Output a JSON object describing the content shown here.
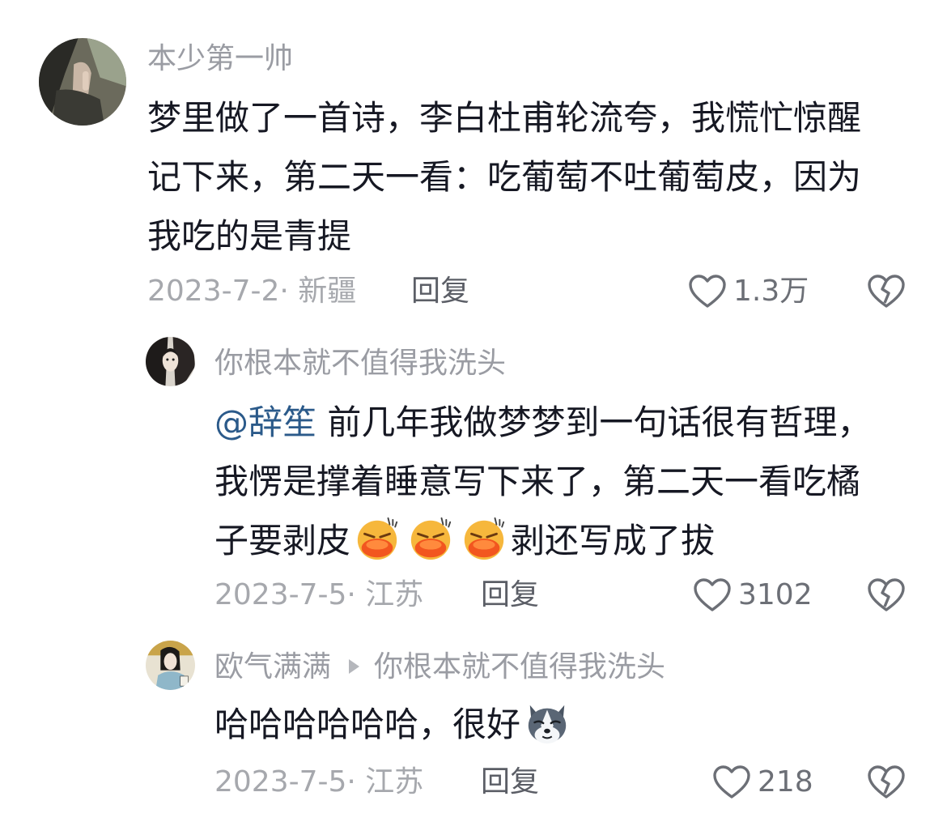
{
  "comments": [
    {
      "username": "本少第一帅",
      "lines": [
        "梦里做了一首诗，李白杜甫轮流夸，我慌忙惊醒",
        "记下来，第二天一看：吃葡萄不吐葡萄皮，因为",
        "我吃的是青提"
      ],
      "meta": "2023-7-2· 新疆",
      "reply_label": "回复",
      "likes": "1.3万"
    },
    {
      "username": "你根本就不值得我洗头",
      "mention": "@辞笙",
      "line1_rest": " 前几年我做梦梦到一句话很有哲理，",
      "line2": "我愣是撑着睡意写下来了，第二天一看吃橘",
      "line3_start": "子要剥皮",
      "line3_end": "剥还写成了拔",
      "emoji": "shy-face-emoji",
      "meta": "2023-7-5· 江苏",
      "reply_label": "回复",
      "likes": "3102"
    },
    {
      "username": "欧气满满",
      "reply_to": "你根本就不值得我洗头",
      "text": "哈哈哈哈哈哈，很好",
      "emoji": "husky-dog-emoji",
      "meta": "2023-7-5· 江苏",
      "reply_label": "回复",
      "likes": "218"
    }
  ],
  "icons": {
    "like": "heart-outline-icon",
    "dislike": "broken-heart-icon"
  },
  "colors": {
    "username": "#9a9ca3",
    "text": "#161823",
    "mention": "#2b5a8a",
    "meta": "#a6a8ad"
  }
}
